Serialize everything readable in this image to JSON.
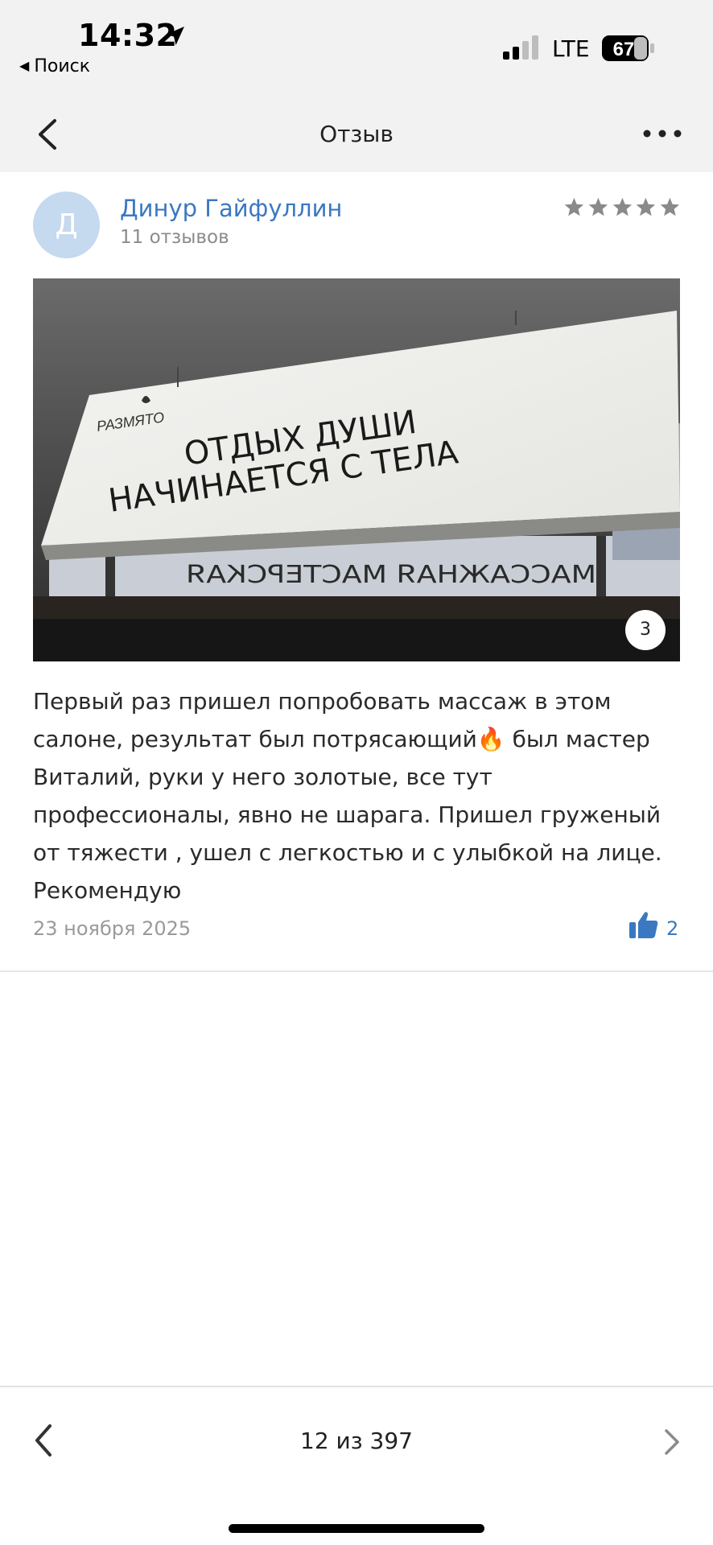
{
  "status_bar": {
    "time": "14:32",
    "back_app_label": "Поиск",
    "network": "LTE",
    "battery": "67",
    "icons": [
      "location-arrow-icon",
      "signal-icon",
      "battery-icon"
    ]
  },
  "nav": {
    "title": "Отзыв",
    "icons": [
      "chevron-left-icon",
      "more-icon"
    ]
  },
  "review": {
    "avatar_letter": "Д",
    "author": "Динур Гайфуллин",
    "reviews_count": "11 отзывов",
    "rating": 5,
    "photo": {
      "count": "3",
      "sign_brand": "РАЗМЯТО",
      "sign_line1": "ОТДЫХ ДУШИ",
      "sign_line2": "НАЧИНАЕТСЯ С ТЕЛА",
      "window_text": "МАССАЖНАЯ МАСТЕРСКАЯ"
    },
    "text": "Первый раз пришел попробовать массаж в этом салоне, результат был потрясающий🔥 был мастер Виталий, руки у него золотые, все тут профессионалы, явно не шарага. Пришел груженый от тяжести , ушел с легкостью и с улыбкой на лице. Рекомендую",
    "date": "23 ноября 2025",
    "likes": "2"
  },
  "pager": {
    "label": "12 из 397"
  },
  "colors": {
    "accent": "#3b78c2",
    "header_bg": "#f2f2f2",
    "star": "#8a8a8a",
    "avatar_bg": "#c5d9ef"
  }
}
